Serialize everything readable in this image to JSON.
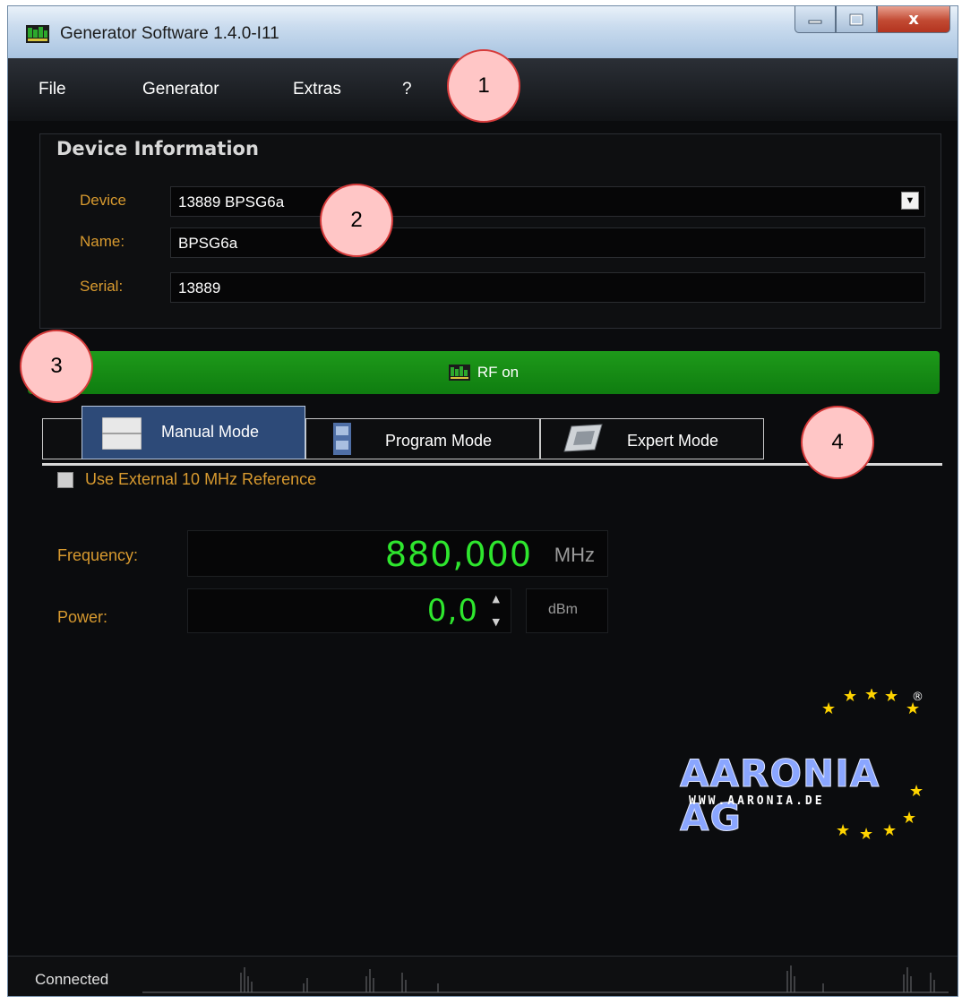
{
  "window": {
    "title": "Generator Software 1.4.0-I11",
    "controls": {
      "minimize": "minimize",
      "maximize": "maximize",
      "close": "x"
    }
  },
  "menu": {
    "items": [
      "File",
      "Generator",
      "Extras",
      "?"
    ]
  },
  "device_info": {
    "title": "Device Information",
    "device_label": "Device",
    "device_value": "13889 BPSG6a",
    "name_label": "Name:",
    "name_value": "BPSG6a",
    "serial_label": "Serial:",
    "serial_value": "13889"
  },
  "rf_button": {
    "label": "RF on",
    "color": "#1a9216"
  },
  "tabs": [
    {
      "label": "Manual Mode",
      "active": true
    },
    {
      "label": "Program Mode",
      "active": false
    },
    {
      "label": "Expert Mode",
      "active": false
    }
  ],
  "manual": {
    "ext_ref_label": "Use External 10 MHz Reference",
    "ext_ref_checked": false,
    "frequency_label": "Frequency:",
    "frequency_value": "880,000",
    "frequency_unit": "MHz",
    "power_label": "Power:",
    "power_value": "0,0",
    "power_unit": "dBm"
  },
  "logo": {
    "name": "AARONIA AG",
    "url": "WWW.AARONIA.DE",
    "registered": "®"
  },
  "status": {
    "text": "Connected"
  },
  "callouts": [
    "1",
    "2",
    "3",
    "4"
  ],
  "colors": {
    "accent_orange": "#d89a2f",
    "value_green": "#2ee62e",
    "active_tab": "#2d4a78"
  }
}
